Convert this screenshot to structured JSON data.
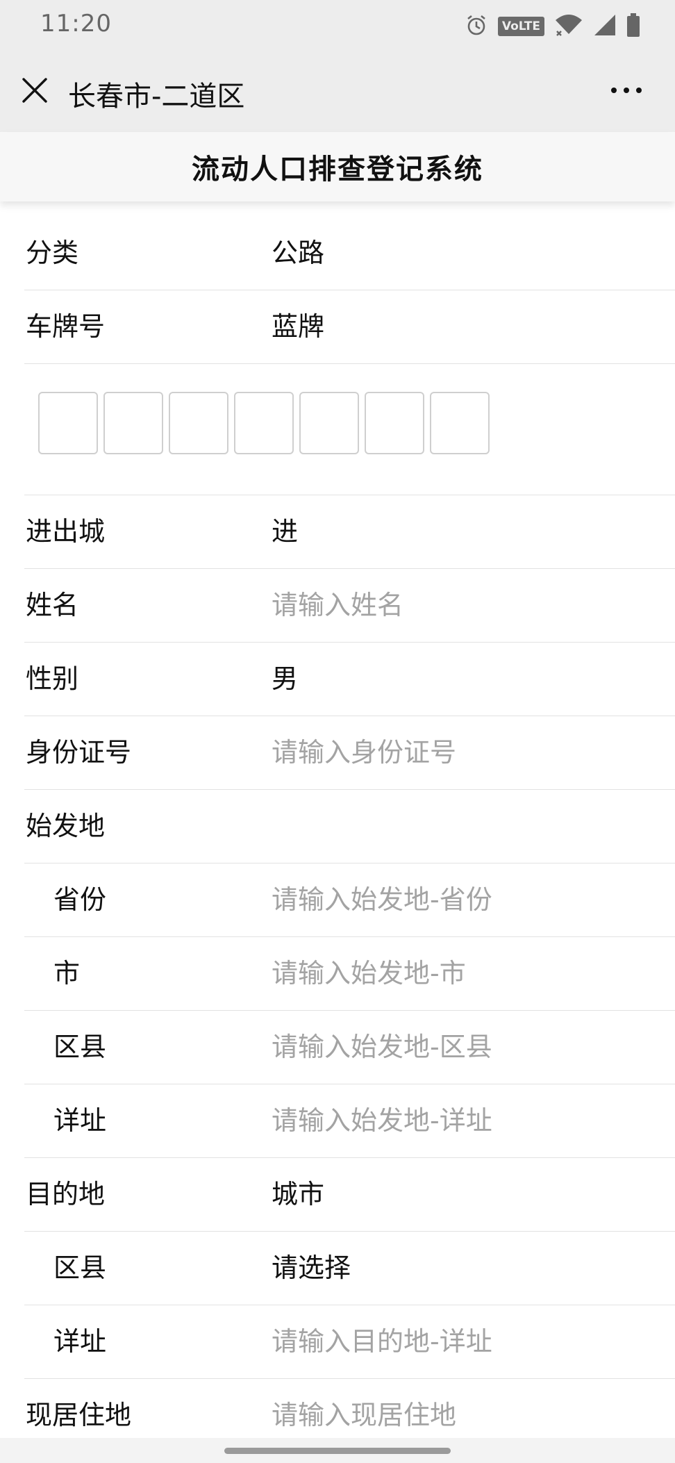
{
  "status_bar": {
    "time": "11:20",
    "network_badge": "VoLTE",
    "icons": [
      "alarm-icon",
      "volte-icon",
      "wifi-icon",
      "cellular-signal-icon",
      "battery-icon"
    ]
  },
  "nav": {
    "title": "长春市-二道区",
    "close_icon": "close-icon",
    "more_icon": "more-dots-icon"
  },
  "page": {
    "title": "流动人口排查登记系统"
  },
  "form": {
    "category": {
      "label": "分类",
      "value": "公路"
    },
    "plate_type": {
      "label": "车牌号",
      "value": "蓝牌"
    },
    "plate_characters": [
      "",
      "",
      "",
      "",
      "",
      "",
      ""
    ],
    "direction": {
      "label": "进出城",
      "value": "进"
    },
    "name": {
      "label": "姓名",
      "placeholder": "请输入姓名"
    },
    "gender": {
      "label": "性别",
      "value": "男"
    },
    "id_number": {
      "label": "身份证号",
      "placeholder": "请输入身份证号"
    },
    "origin": {
      "label": "始发地",
      "province": {
        "label": "省份",
        "placeholder": "请输入始发地-省份"
      },
      "city": {
        "label": "市",
        "placeholder": "请输入始发地-市"
      },
      "district": {
        "label": "区县",
        "placeholder": "请输入始发地-区县"
      },
      "detail": {
        "label": "详址",
        "placeholder": "请输入始发地-详址"
      }
    },
    "destination": {
      "label": "目的地",
      "value": "城市",
      "district": {
        "label": "区县",
        "value": "请选择"
      },
      "detail": {
        "label": "详址",
        "placeholder": "请输入目的地-详址"
      }
    },
    "current_address": {
      "label": "现居住地",
      "placeholder": "请输入现居住地"
    }
  },
  "colors": {
    "bar_background": "#ededed",
    "text": "#111111",
    "placeholder": "#a3a3a3",
    "divider": "#e2e2e2"
  }
}
